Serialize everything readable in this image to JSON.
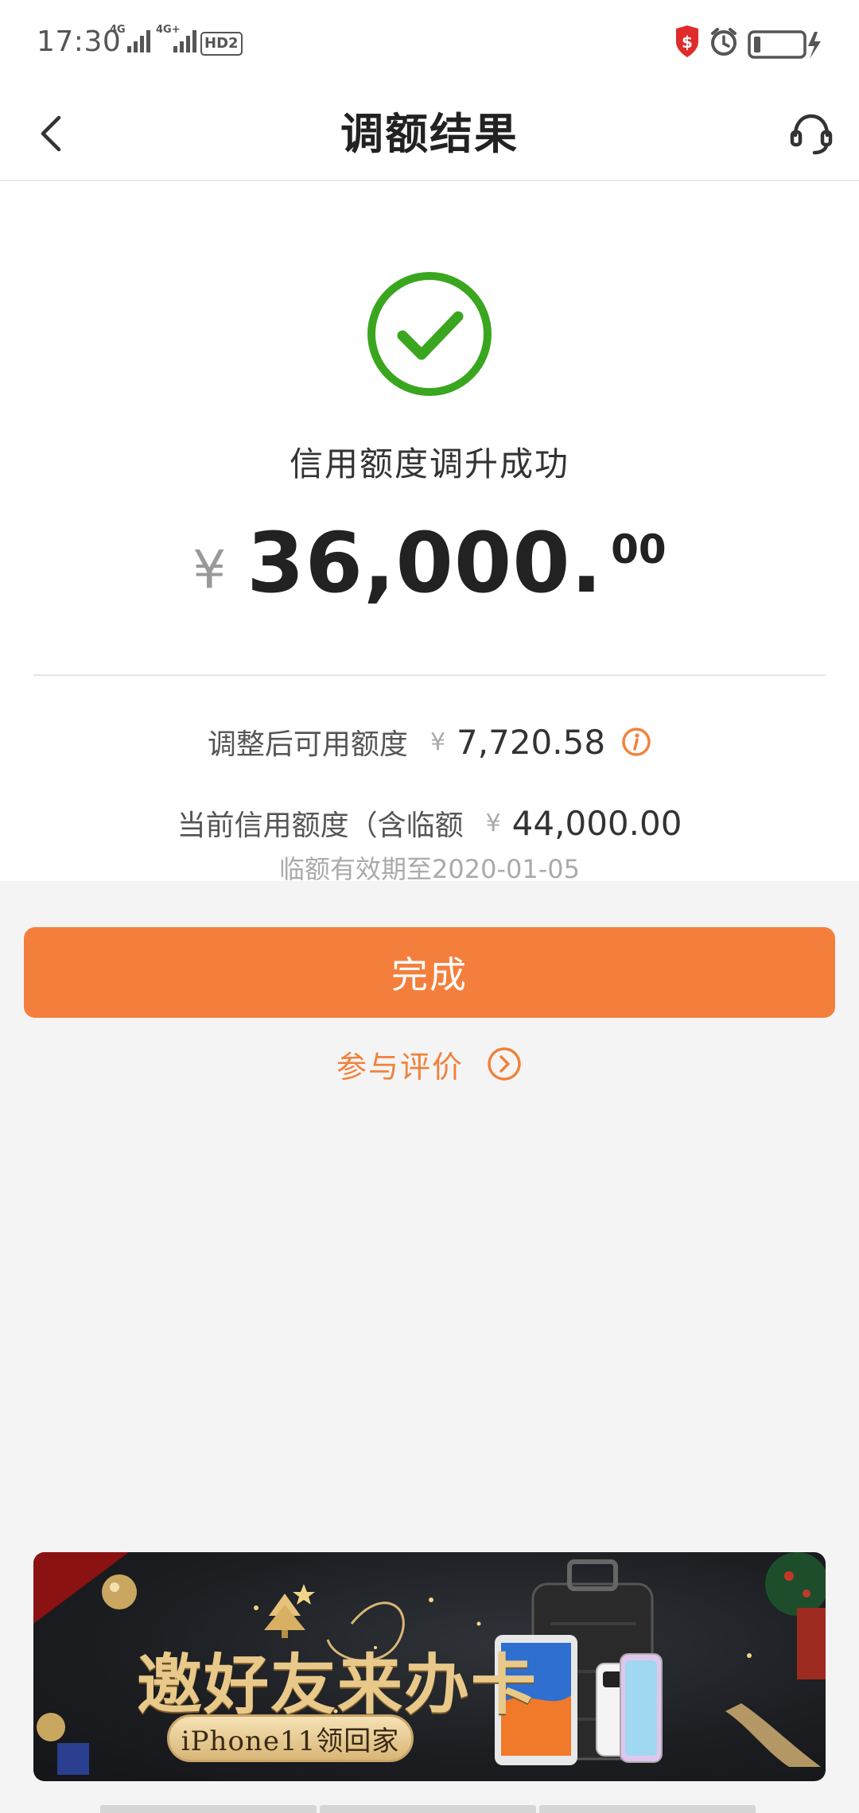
{
  "status_bar": {
    "time": "17:30",
    "signal1_label": "4G",
    "signal2_label": "4G+",
    "hd_label": "HD2",
    "battery_icon": "battery-charging-icon",
    "alarm_icon": "alarm-icon",
    "security_icon": "shield-icon"
  },
  "nav": {
    "title": "调额结果",
    "back_icon": "chevron-left-icon",
    "support_icon": "headset-icon"
  },
  "result": {
    "success_icon": "check-circle-icon",
    "message": "信用额度调升成功",
    "currency": "¥",
    "amount_main": "36,000.",
    "amount_decimals": "00",
    "available_label": "调整后可用额度",
    "available_currency": "¥",
    "available_value": "7,720.58",
    "current_label": "当前信用额度（含临额",
    "current_currency": "¥",
    "current_value": "44,000.00",
    "temp_note": "临额有效期至2020-01-05"
  },
  "actions": {
    "done_label": "完成",
    "feedback_label": "参与评价"
  },
  "banner": {
    "title": "邀好友来办卡",
    "subtitle": "iPhone11领回家"
  },
  "colors": {
    "accent": "#f47f3c",
    "success": "#3aa61f",
    "background": "#f4f4f4"
  }
}
